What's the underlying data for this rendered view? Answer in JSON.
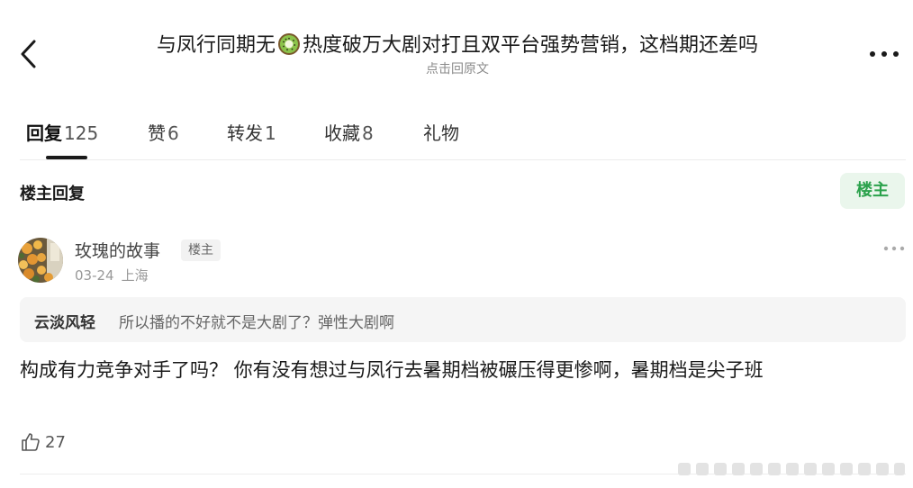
{
  "header": {
    "title_part1": "与凤行同期无",
    "title_emoji_icon": "kiwi-emoji",
    "title_part2": "热度破万大剧对打且双平台强势营销，这档期还差吗",
    "subtitle": "点击回原文"
  },
  "tabs": [
    {
      "label": "回复",
      "count": "125",
      "active": true
    },
    {
      "label": "赞",
      "count": "6",
      "active": false
    },
    {
      "label": "转发",
      "count": "1",
      "active": false
    },
    {
      "label": "收藏",
      "count": "8",
      "active": false
    },
    {
      "label": "礼物",
      "count": "",
      "active": false
    }
  ],
  "section": {
    "title": "楼主回复",
    "owner_chip": "楼主"
  },
  "post": {
    "username": "玫瑰的故事",
    "badge": "楼主",
    "date": "03-24",
    "location": "上海",
    "quote_author": "云淡风轻",
    "quote_text": "所以播的不好就不是大剧了？弹性大剧啊",
    "content": "构成有力竞争对手了吗？ 你有没有想过与凤行去暑期档被碾压得更惨啊，暑期档是尖子班",
    "like_count": "27"
  },
  "colors": {
    "accent_green": "#2ba24c",
    "chip_bg": "#eaf6ec",
    "quote_bg": "#f5f5f5"
  }
}
